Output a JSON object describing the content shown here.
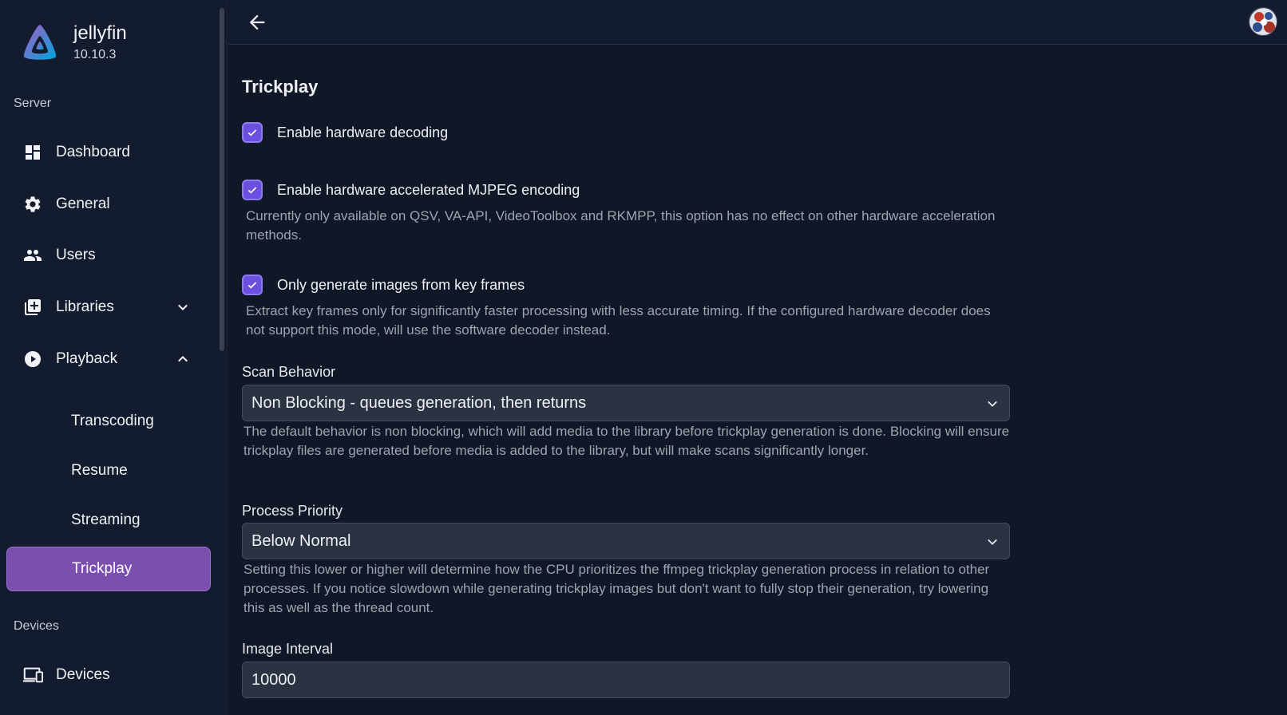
{
  "brand": {
    "name": "jellyfin",
    "version": "10.10.3"
  },
  "sidebar": {
    "section_server": "Server",
    "section_devices": "Devices",
    "items": [
      {
        "label": "Dashboard",
        "icon": "dashboard-icon"
      },
      {
        "label": "General",
        "icon": "gear-icon"
      },
      {
        "label": "Users",
        "icon": "users-icon"
      },
      {
        "label": "Libraries",
        "icon": "library-add-icon",
        "expanded": false
      },
      {
        "label": "Playback",
        "icon": "play-circle-icon",
        "expanded": true
      },
      {
        "label": "Transcoding"
      },
      {
        "label": "Resume"
      },
      {
        "label": "Streaming"
      },
      {
        "label": "Trickplay",
        "active": true
      },
      {
        "label": "Devices",
        "icon": "devices-icon"
      }
    ]
  },
  "header": {
    "back_icon": "arrow-left-icon",
    "avatar": "user-avatar"
  },
  "main": {
    "title": "Trickplay",
    "hw_decoding": {
      "label": "Enable hardware decoding",
      "checked": true
    },
    "mjpeg": {
      "label": "Enable hardware accelerated MJPEG encoding",
      "checked": true,
      "help": "Currently only available on QSV, VA-API, VideoToolbox and RKMPP, this option has no effect on other hardware acceleration methods."
    },
    "keyframes": {
      "label": "Only generate images from key frames",
      "checked": true,
      "help": "Extract key frames only for significantly faster processing with less accurate timing. If the configured hardware decoder does not support this mode, will use the software decoder instead."
    },
    "scan_behavior": {
      "label": "Scan Behavior",
      "value": "Non Blocking - queues generation, then returns",
      "help": "The default behavior is non blocking, which will add media to the library before trickplay generation is done. Blocking will ensure trickplay files are generated before media is added to the library, but will make scans significantly longer."
    },
    "process_priority": {
      "label": "Process Priority",
      "value": "Below Normal",
      "help": "Setting this lower or higher will determine how the CPU prioritizes the ffmpeg trickplay generation process in relation to other processes. If you notice slowdown while generating trickplay images but don't want to fully stop their generation, try lowering this as well as the thread count."
    },
    "image_interval": {
      "label": "Image Interval",
      "value": "10000"
    }
  },
  "colors": {
    "accent": "#7b4fb0",
    "checkbox": "#6a4fe0",
    "background": "#101827",
    "sidebar": "#131c2e"
  }
}
